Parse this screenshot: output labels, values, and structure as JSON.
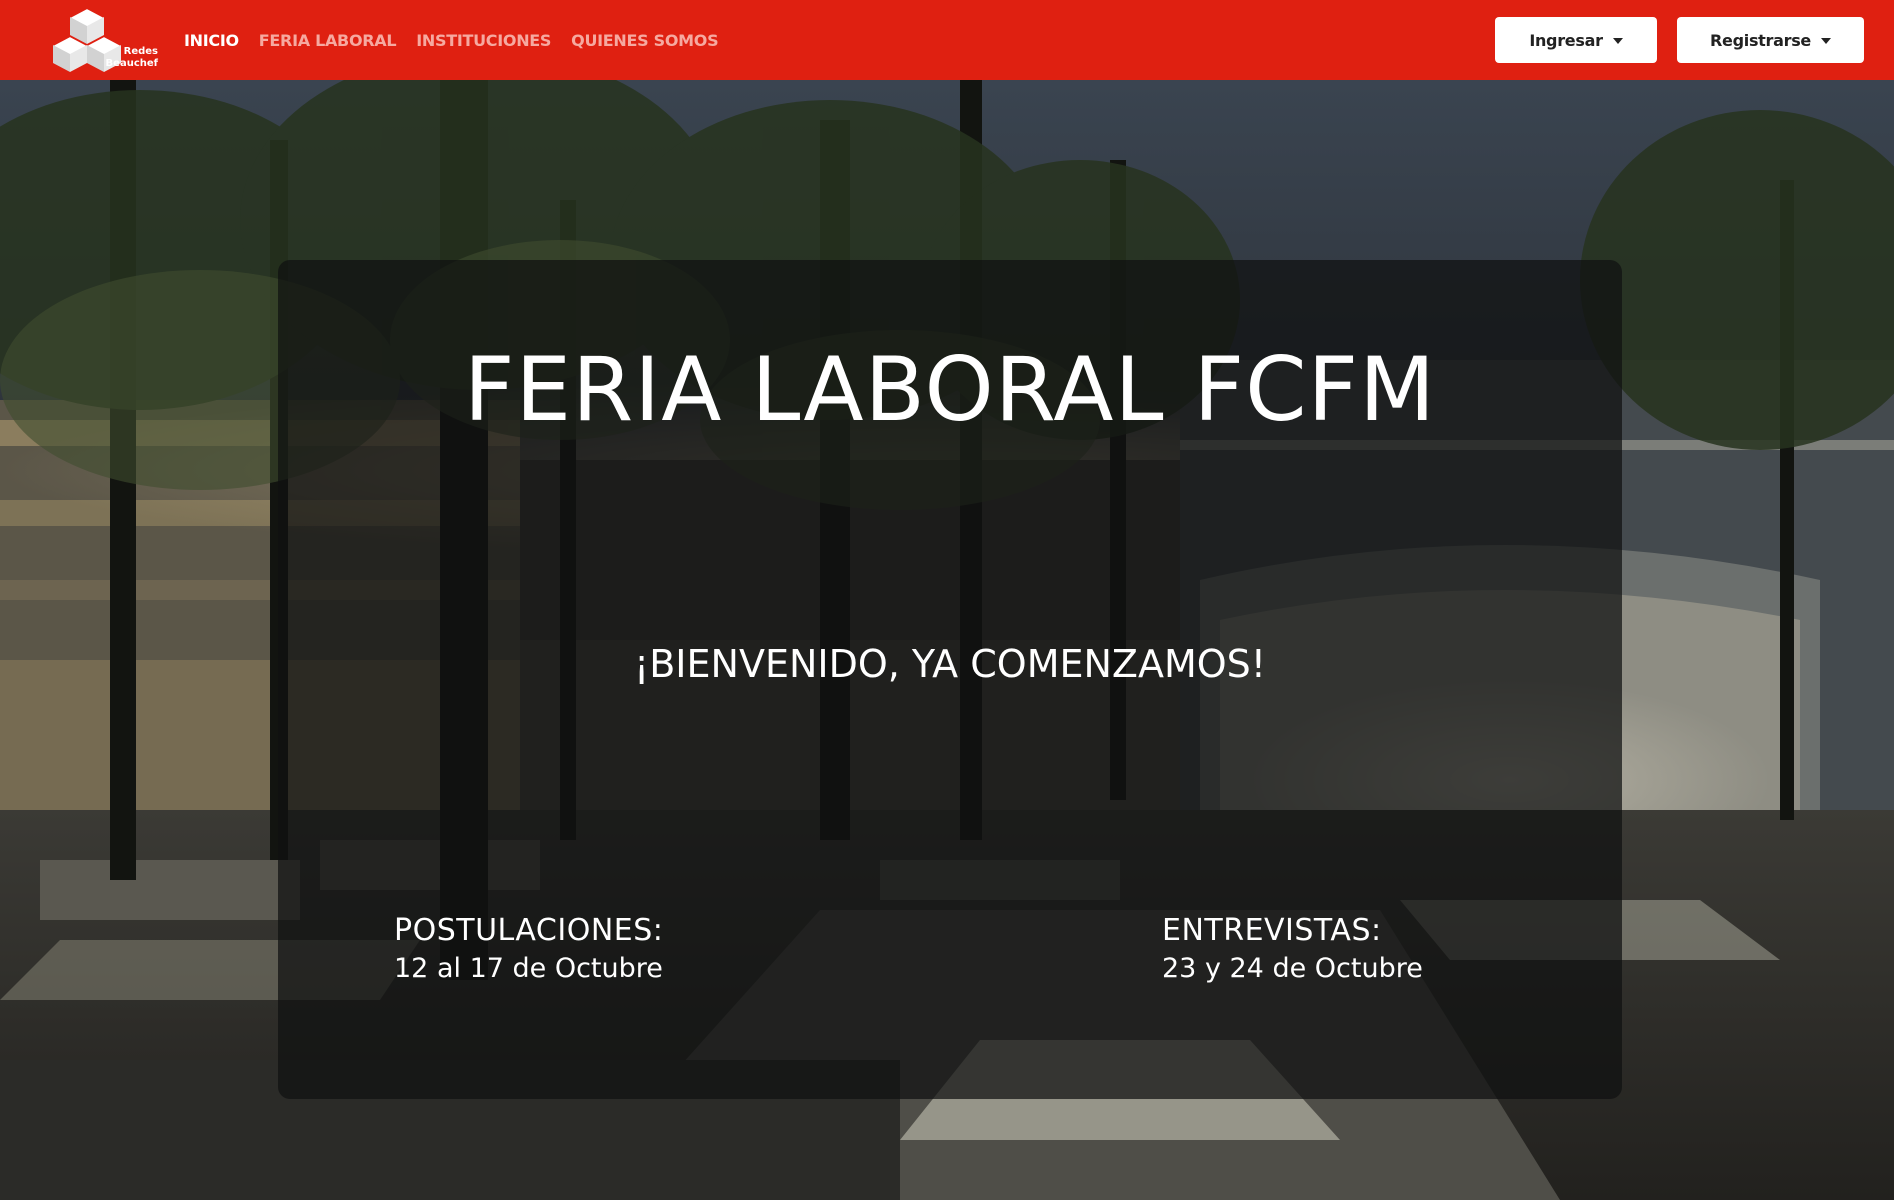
{
  "navbar": {
    "logo": {
      "line1": "Redes",
      "line2": "Beauchef"
    },
    "links": [
      {
        "label": "INICIO",
        "active": true
      },
      {
        "label": "FERIA LABORAL",
        "active": false
      },
      {
        "label": "INSTITUCIONES",
        "active": false
      },
      {
        "label": "QUIENES SOMOS",
        "active": false
      }
    ],
    "login_label": "Ingresar",
    "register_label": "Registrarse"
  },
  "hero": {
    "title": "FERIA LABORAL FCFM",
    "subtitle": "¡BIENVENIDO, YA COMENZAMOS!",
    "applications": {
      "label": "POSTULACIONES:",
      "dates": "12 al 17 de Octubre"
    },
    "interviews": {
      "label": "ENTREVISTAS:",
      "dates": "23 y 24 de Octubre"
    }
  },
  "colors": {
    "navbar_bg": "#df2011",
    "nav_link": "#f6a9a0",
    "nav_link_active": "#ffffff",
    "button_bg": "#ffffff",
    "overlay": "rgba(15,16,17,0.72)"
  },
  "icons": {
    "logo": "hexagon-cubes-logo",
    "dropdown": "caret-down-icon"
  }
}
